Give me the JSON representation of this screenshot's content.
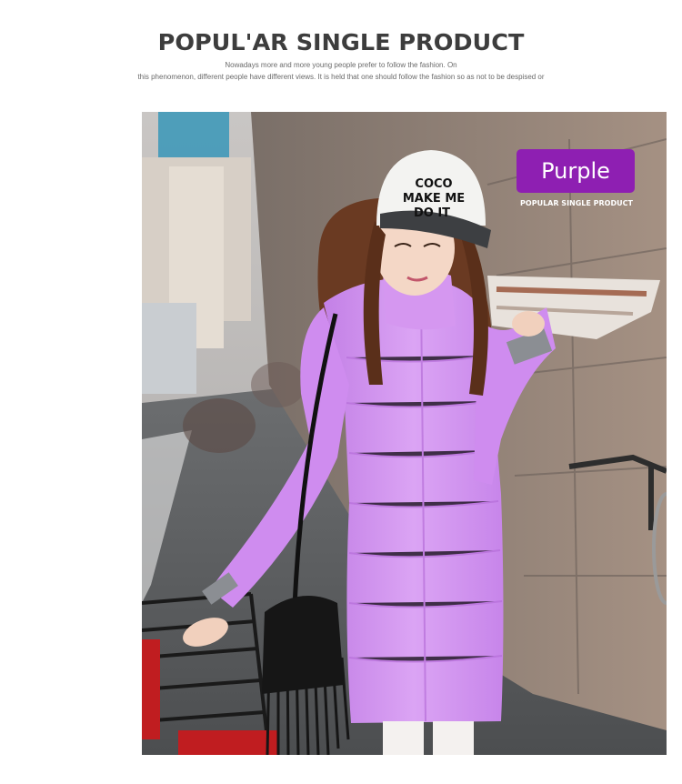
{
  "header": {
    "title": "POPUL'AR SINGLE PRODUCT",
    "subtitle_line1": "Nowadays more and more young people prefer to follow the fashion. On",
    "subtitle_line2": "this phenomenon, different people have different views. It is held that one should follow the fashion so as not to be despised or"
  },
  "product": {
    "color_label": "Purple",
    "color_caption": "POPULAR SINGLE PRODUCT",
    "colors": {
      "accent": "#8e1fb2",
      "coat": "#d69af0"
    },
    "cap_text": [
      "COCO",
      "MAKE ME",
      "DO IT"
    ]
  }
}
